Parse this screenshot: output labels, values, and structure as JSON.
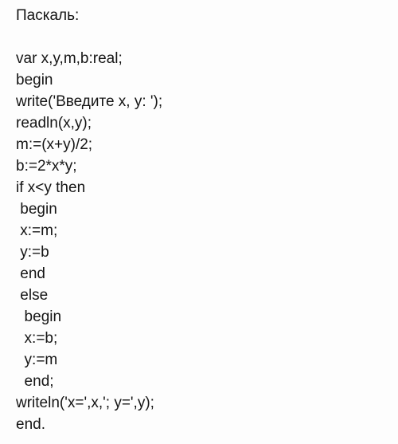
{
  "document": {
    "language_label": "Паскаль:",
    "background_color": "#fdfdfd",
    "text_color": "#151515",
    "blank_line": " ",
    "code_lines": [
      {
        "indent": 0,
        "text": "var x,y,m,b:real;"
      },
      {
        "indent": 0,
        "text": "begin"
      },
      {
        "indent": 0,
        "text": "write('Введите x, y: ');"
      },
      {
        "indent": 0,
        "text": "readln(x,y);"
      },
      {
        "indent": 0,
        "text": "m:=(x+y)/2;"
      },
      {
        "indent": 0,
        "text": "b:=2*x*y;"
      },
      {
        "indent": 0,
        "text": "if x<y then"
      },
      {
        "indent": 1,
        "text": " begin"
      },
      {
        "indent": 1,
        "text": " x:=m;"
      },
      {
        "indent": 1,
        "text": " y:=b"
      },
      {
        "indent": 1,
        "text": " end"
      },
      {
        "indent": 1,
        "text": " else"
      },
      {
        "indent": 2,
        "text": "  begin"
      },
      {
        "indent": 2,
        "text": "  x:=b;"
      },
      {
        "indent": 2,
        "text": "  y:=m"
      },
      {
        "indent": 2,
        "text": "  end;"
      },
      {
        "indent": 0,
        "text": "writeln('x=',x,'; y=',y);"
      },
      {
        "indent": 0,
        "text": "end."
      }
    ]
  }
}
